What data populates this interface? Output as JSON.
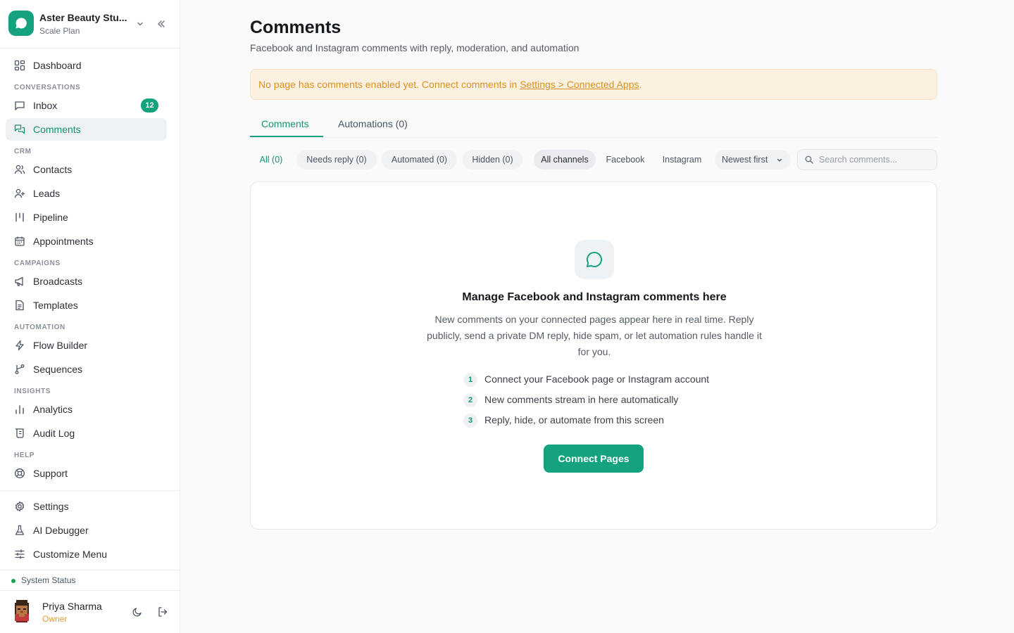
{
  "workspace": {
    "name": "Aster Beauty Stu...",
    "plan": "Scale Plan"
  },
  "nav": {
    "dashboard": "Dashboard",
    "section_conversations": "CONVERSATIONS",
    "inbox": "Inbox",
    "inbox_badge": "12",
    "comments": "Comments",
    "section_crm": "CRM",
    "contacts": "Contacts",
    "leads": "Leads",
    "pipeline": "Pipeline",
    "appointments": "Appointments",
    "section_campaigns": "CAMPAIGNS",
    "broadcasts": "Broadcasts",
    "templates": "Templates",
    "section_automation": "AUTOMATION",
    "flow_builder": "Flow Builder",
    "sequences": "Sequences",
    "section_insights": "INSIGHTS",
    "analytics": "Analytics",
    "audit_log": "Audit Log",
    "section_help": "HELP",
    "support": "Support",
    "settings": "Settings",
    "ai_debugger": "AI Debugger",
    "customize_menu": "Customize Menu"
  },
  "system_status": "System Status",
  "user": {
    "name": "Priya Sharma",
    "role": "Owner"
  },
  "page": {
    "title": "Comments",
    "subtitle": "Facebook and Instagram comments with reply, moderation, and automation"
  },
  "alert": {
    "text": "No page has comments enabled yet. Connect comments in ",
    "link": "Settings > Connected Apps",
    "suffix": "."
  },
  "tabs": {
    "comments": "Comments",
    "automations": "Automations (0)"
  },
  "filters": {
    "all": "All (0)",
    "needs_reply": "Needs reply (0)",
    "automated": "Automated (0)",
    "hidden": "Hidden (0)",
    "all_channels": "All channels",
    "facebook": "Facebook",
    "instagram": "Instagram",
    "sort": "Newest first"
  },
  "search": {
    "placeholder": "Search comments..."
  },
  "empty": {
    "title": "Manage Facebook and Instagram comments here",
    "description": "New comments on your connected pages appear here in real time. Reply publicly, send a private DM reply, hide spam, or let automation rules handle it for you.",
    "steps": [
      {
        "num": "1",
        "text": "Connect your Facebook page or Instagram account"
      },
      {
        "num": "2",
        "text": "New comments stream in here automatically"
      },
      {
        "num": "3",
        "text": "Reply, hide, or automate from this screen"
      }
    ],
    "button": "Connect Pages"
  },
  "colors": {
    "accent": "#15a37f",
    "warning_bg": "#fcf0e0",
    "warning_text": "#d9911e"
  }
}
